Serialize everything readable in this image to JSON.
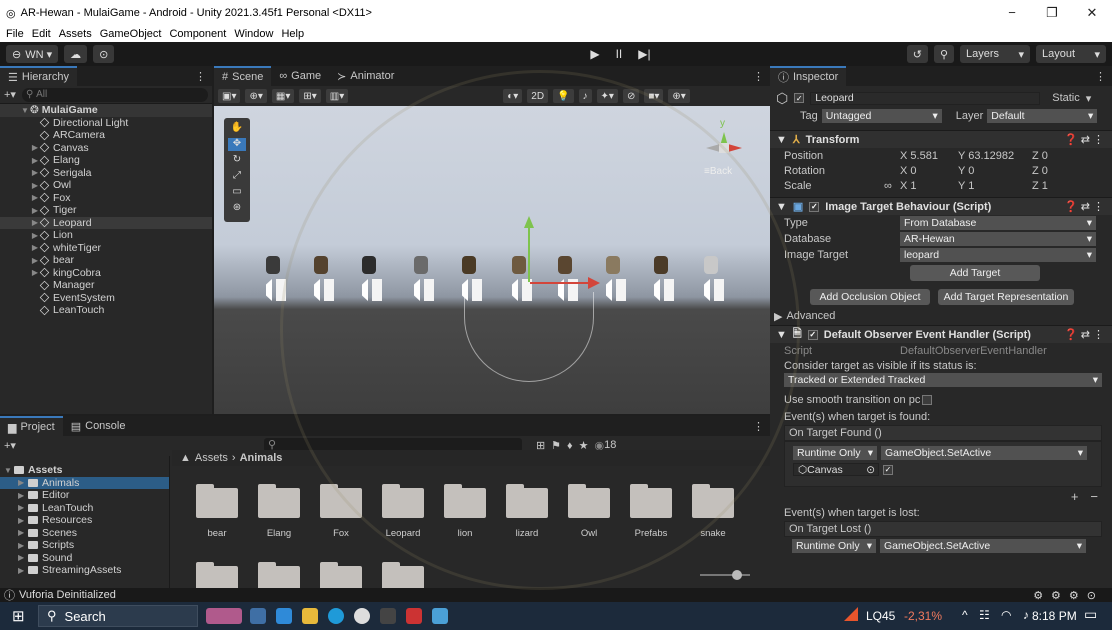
{
  "window": {
    "title": "AR-Hewan - MulaiGame - Android - Unity 2021.3.45f1 Personal <DX11>",
    "min": "−",
    "max": "❐",
    "close": "✕"
  },
  "menu": [
    "File",
    "Edit",
    "Assets",
    "GameObject",
    "Component",
    "Window",
    "Help"
  ],
  "toolbar": {
    "account": "WN ▾",
    "play": "▶",
    "pause": "II",
    "step": "▶|",
    "layers": "Layers",
    "layout": "Layout"
  },
  "hierarchy": {
    "tab": "Hierarchy",
    "search_placeholder": "All",
    "root": "MulaiGame",
    "items": [
      {
        "label": "Directional Light",
        "expand": false,
        "selected": false
      },
      {
        "label": "ARCamera",
        "expand": false,
        "selected": false
      },
      {
        "label": "Canvas",
        "expand": true,
        "selected": false
      },
      {
        "label": "Elang",
        "expand": true,
        "selected": false
      },
      {
        "label": "Serigala",
        "expand": true,
        "selected": false
      },
      {
        "label": "Owl",
        "expand": true,
        "selected": false
      },
      {
        "label": "Fox",
        "expand": true,
        "selected": false
      },
      {
        "label": "Tiger",
        "expand": true,
        "selected": false
      },
      {
        "label": "Leopard",
        "expand": true,
        "selected": true
      },
      {
        "label": "Lion",
        "expand": true,
        "selected": false
      },
      {
        "label": "whiteTiger",
        "expand": true,
        "selected": false
      },
      {
        "label": "bear",
        "expand": true,
        "selected": false
      },
      {
        "label": "kingCobra",
        "expand": true,
        "selected": false
      },
      {
        "label": "Manager",
        "expand": false,
        "selected": false
      },
      {
        "label": "EventSystem",
        "expand": false,
        "selected": false
      },
      {
        "label": "LeanTouch",
        "expand": false,
        "selected": false
      }
    ]
  },
  "scene": {
    "tabs": [
      "Scene",
      "Game",
      "Animator"
    ],
    "mode2d": "2D",
    "back": "≡Back",
    "axis_y": "y"
  },
  "inspector": {
    "tab": "Inspector",
    "object_name": "Leopard",
    "static": "Static",
    "tag_label": "Tag",
    "tag": "Untagged",
    "layer_label": "Layer",
    "layer": "Default",
    "transform": {
      "title": "Transform",
      "position_label": "Position",
      "px": "5.581",
      "py": "63.12982",
      "pz": "0",
      "rotation_label": "Rotation",
      "rx": "0",
      "ry": "0",
      "rz": "0",
      "scale_label": "Scale",
      "sx": "1",
      "sy": "1",
      "sz": "1"
    },
    "itb": {
      "title": "Image Target Behaviour (Script)",
      "type_label": "Type",
      "type": "From Database",
      "database_label": "Database",
      "database": "AR-Hewan",
      "image_target_label": "Image Target",
      "image_target": "leopard",
      "add_target": "Add Target",
      "add_occlusion": "Add Occlusion Object",
      "add_representation": "Add Target Representation",
      "advanced": "Advanced"
    },
    "doeh": {
      "title": "Default Observer Event Handler (Script)",
      "script_label": "Script",
      "script": "DefaultObserverEventHandler",
      "consider": "Consider target as visible if its status is:",
      "status": "Tracked or Extended Tracked",
      "smooth": "Use smooth transition on pc",
      "found_label": "Event(s) when target is found:",
      "found_event": "On Target Found ()",
      "runtime": "Runtime Only",
      "method": "GameObject.SetActive",
      "canvas": "Canvas",
      "lost_label": "Event(s) when target is lost:",
      "lost_event": "On Target Lost ()",
      "plus": "+",
      "minus": "−"
    }
  },
  "project": {
    "tabs": [
      "Project",
      "Console"
    ],
    "breadcrumb_root": "Assets",
    "breadcrumb_current": "Animals",
    "count": "18",
    "tree": [
      {
        "label": "Assets",
        "level": 0
      },
      {
        "label": "Animals",
        "level": 1,
        "selected": true
      },
      {
        "label": "Editor",
        "level": 1
      },
      {
        "label": "LeanTouch",
        "level": 1
      },
      {
        "label": "Resources",
        "level": 1
      },
      {
        "label": "Scenes",
        "level": 1
      },
      {
        "label": "Scripts",
        "level": 1
      },
      {
        "label": "Sound",
        "level": 1
      },
      {
        "label": "StreamingAssets",
        "level": 1
      }
    ],
    "folders": [
      "bear",
      "Elang",
      "Fox",
      "Leopard",
      "lion",
      "lizard",
      "Owl",
      "Prefabs",
      "snake"
    ]
  },
  "status": {
    "text": "Vuforia Deinitialized"
  },
  "taskbar": {
    "search": "Search",
    "stock": "LQ45",
    "change": "-2,31%",
    "time": "8:18 PM"
  }
}
